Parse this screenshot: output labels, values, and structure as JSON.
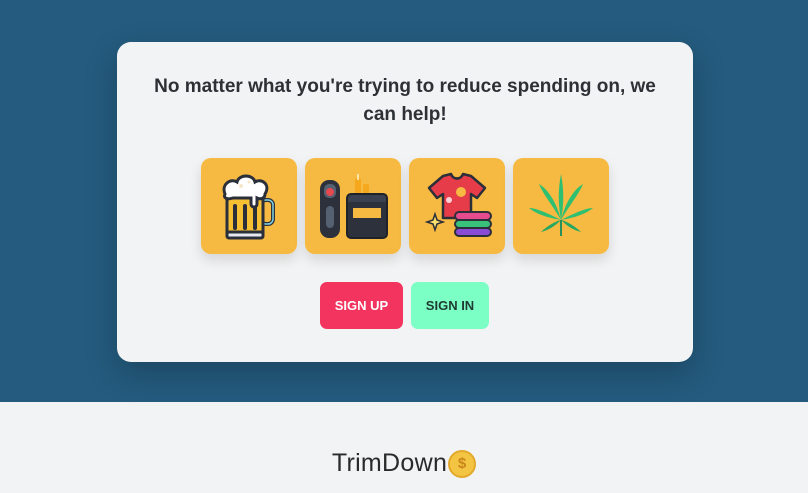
{
  "hero": {
    "headline": "No matter what you're trying to reduce spending on, we can help!",
    "categories": [
      {
        "icon": "beer-mug-icon"
      },
      {
        "icon": "vape-and-cigarettes-icon"
      },
      {
        "icon": "clothing-icon"
      },
      {
        "icon": "cannabis-leaf-icon"
      }
    ],
    "signup_label": "SIGN UP",
    "signin_label": "SIGN IN"
  },
  "footer": {
    "brand_name": "TrimDown",
    "brand_symbol": "$"
  },
  "colors": {
    "hero_bg": "#245b7e",
    "tile_bg": "#f6b941",
    "signup_bg": "#f2345e",
    "signin_bg": "#7cffc4"
  }
}
